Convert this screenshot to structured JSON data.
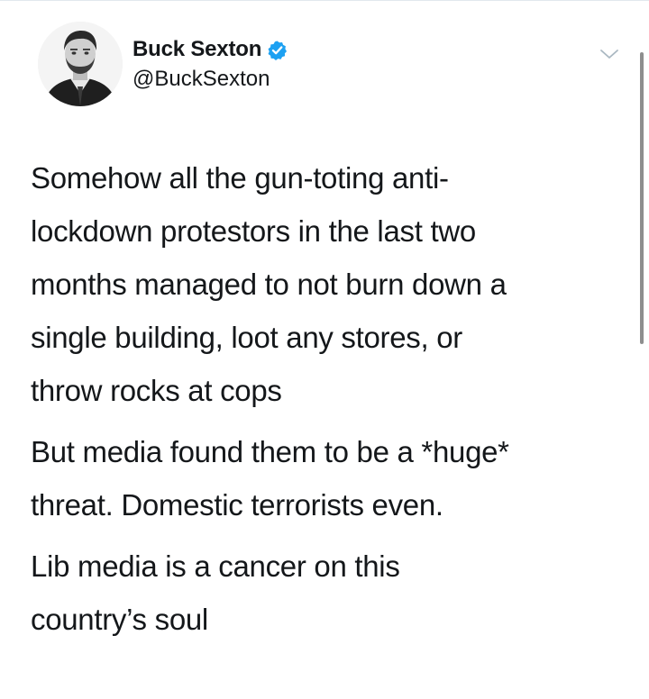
{
  "tweet": {
    "author": {
      "display_name": "Buck Sexton",
      "handle": "@BuckSexton",
      "verified": true,
      "avatar_icon": "profile-photo",
      "verified_icon": "verified-badge-icon"
    },
    "menu_icon": "chevron-down-icon",
    "paragraphs": [
      "Somehow all the gun-toting anti-\nlockdown protestors in the last two\nmonths managed to not burn down a\nsingle building, loot any stores, or\nthrow rocks at cops",
      "But media found them to be a *huge*\nthreat. Domestic terrorists even.",
      "Lib media is a cancer on this\ncountry’s soul"
    ]
  },
  "colors": {
    "text": "#14171a",
    "verified_blue": "#1da1f2",
    "chevron": "#aab8c2",
    "scrollbar": "#8e8e8e"
  }
}
